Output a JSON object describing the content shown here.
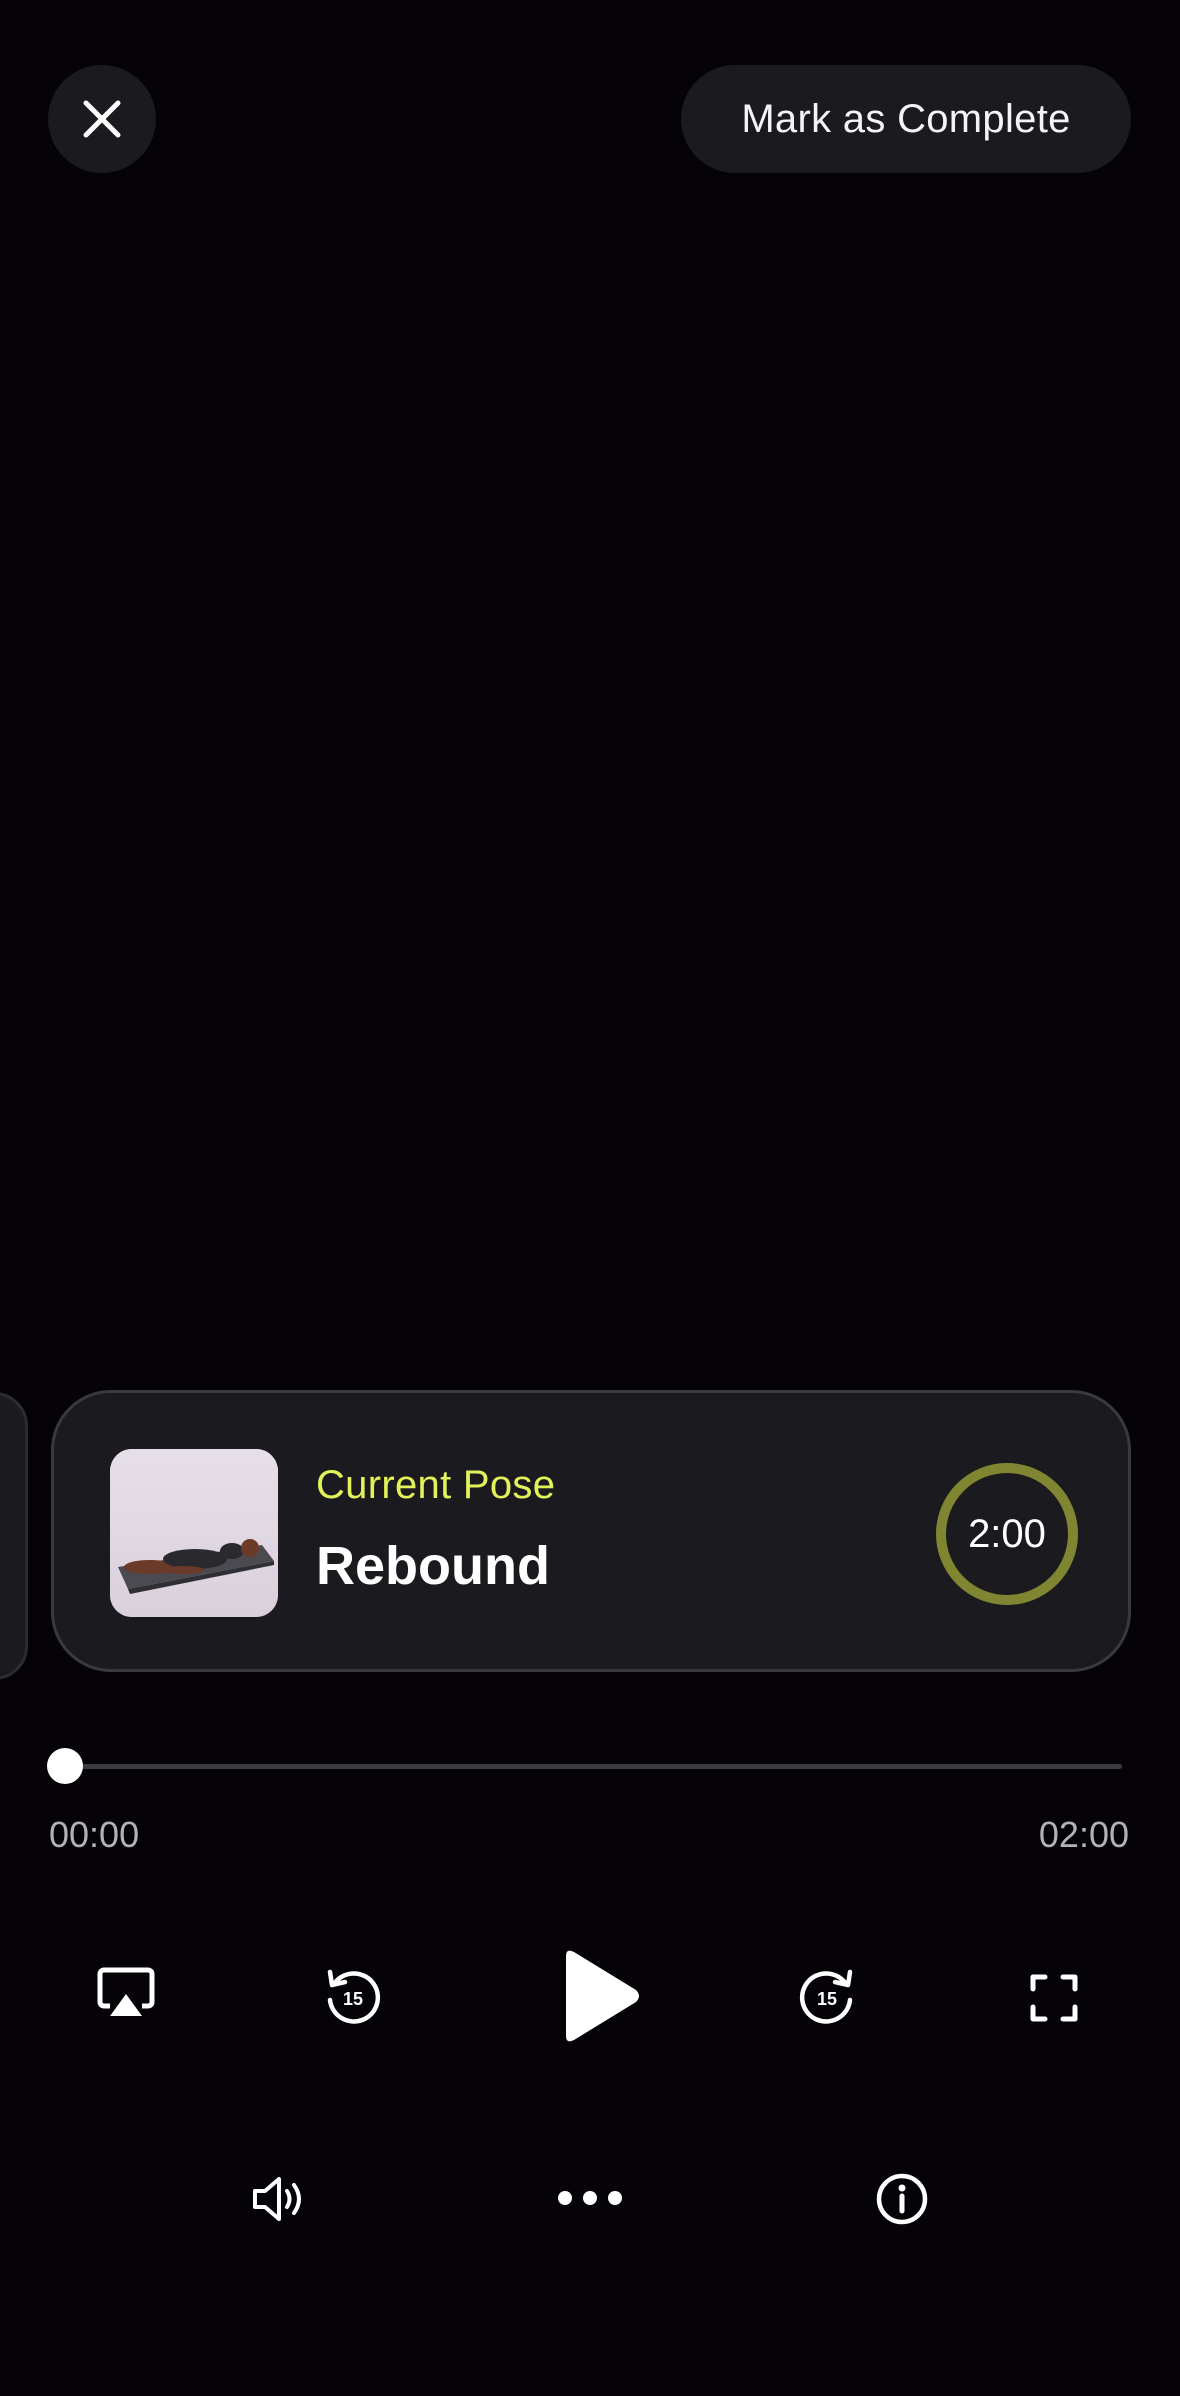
{
  "header": {
    "close_icon": "close-icon",
    "complete_label": "Mark as Complete"
  },
  "pose": {
    "subtitle": "Current Pose",
    "title": "Rebound",
    "timer": "2:00",
    "timer_progress": 1.0,
    "thumbnail": "person-lying-on-mat-image"
  },
  "player": {
    "elapsed": "00:00",
    "duration": "02:00",
    "progress": 0.0
  },
  "controls": {
    "row1": [
      "airplay-icon",
      "rewind-15-icon",
      "play-icon",
      "forward-15-icon",
      "fullscreen-icon"
    ],
    "rewind_seconds": "15",
    "forward_seconds": "15",
    "row2": [
      "volume-icon",
      "more-icon",
      "info-icon"
    ]
  },
  "colors": {
    "background": "#050307",
    "card": "#1b1a1e",
    "accent": "#e3f25a",
    "timer_ring": "#7f8530"
  }
}
